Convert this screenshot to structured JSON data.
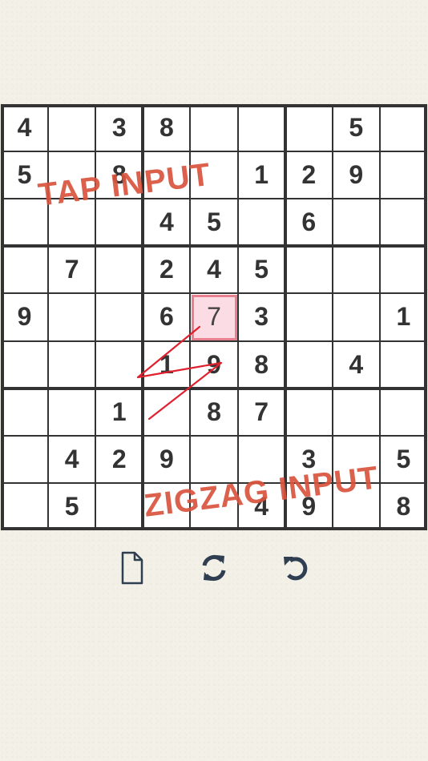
{
  "board": {
    "rows": [
      [
        "4",
        "",
        "3",
        "8",
        "",
        "",
        "",
        "5",
        ""
      ],
      [
        "5",
        "",
        "8",
        "",
        "",
        "1",
        "2",
        "9",
        ""
      ],
      [
        "",
        "",
        "",
        "4",
        "5",
        "",
        "6",
        "",
        ""
      ],
      [
        "",
        "7",
        "",
        "2",
        "4",
        "5",
        "",
        "",
        ""
      ],
      [
        "9",
        "",
        "",
        "6",
        "7",
        "3",
        "",
        "",
        "1"
      ],
      [
        "",
        "",
        "",
        "1",
        "9",
        "8",
        "",
        "4",
        ""
      ],
      [
        "",
        "",
        "1",
        "",
        "8",
        "7",
        "",
        "",
        ""
      ],
      [
        "",
        "4",
        "2",
        "9",
        "",
        "",
        "3",
        "",
        "5"
      ],
      [
        "",
        "5",
        "",
        "",
        "",
        "4",
        "9",
        "",
        "8"
      ]
    ],
    "selected": {
      "row": 4,
      "col": 4
    }
  },
  "labels": {
    "tap": "TAP INPUT",
    "zigzag": "ZIGZAG INPUT"
  },
  "toolbar": {
    "new": "document-icon",
    "refresh": "refresh-icon",
    "undo": "undo-icon"
  },
  "colors": {
    "background": "#f2f0e7",
    "digit": "#333333",
    "selected_fill": "#fbdce4",
    "selected_border": "#e9808f",
    "label": "#d9543d",
    "stroke": "#e0202e",
    "icon": "#2f3e51"
  }
}
